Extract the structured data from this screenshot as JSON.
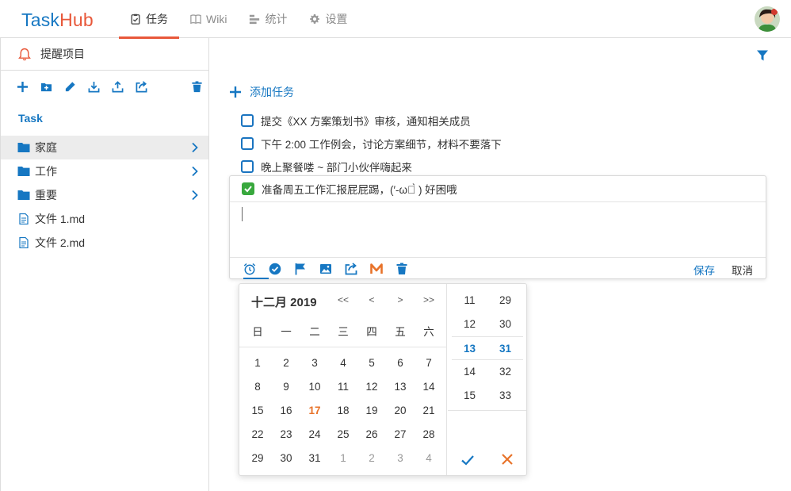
{
  "app": {
    "logo_task": "Task",
    "logo_hub": "Hub"
  },
  "nav": [
    {
      "label": "任务",
      "icon": "clipboard-check-icon",
      "active": true
    },
    {
      "label": "Wiki",
      "icon": "book-icon",
      "active": false
    },
    {
      "label": "统计",
      "icon": "bar-list-icon",
      "active": false
    },
    {
      "label": "设置",
      "icon": "gear-icon",
      "active": false
    }
  ],
  "sidebar": {
    "remind_label": "提醒项目",
    "toolbar_icons": [
      "add-icon",
      "add-folder-icon",
      "edit-icon",
      "download-icon",
      "upload-icon",
      "move-icon",
      "trash-icon"
    ],
    "section_title": "Task",
    "items": [
      {
        "label": "家庭",
        "type": "folder",
        "selected": true
      },
      {
        "label": "工作",
        "type": "folder",
        "selected": false
      },
      {
        "label": "重要",
        "type": "folder",
        "selected": false
      },
      {
        "label": "文件 1.md",
        "type": "file",
        "selected": false
      },
      {
        "label": "文件 2.md",
        "type": "file",
        "selected": false
      }
    ]
  },
  "main": {
    "add_task_label": "添加任务",
    "todos": [
      {
        "text": "提交《XX 方案策划书》审核，通知相关成员",
        "checked": false
      },
      {
        "text": "下午 2:00 工作例会，讨论方案细节，材料不要落下",
        "checked": false
      },
      {
        "text": "晚上聚餐喽 ~ 部门小伙伴嗨起来",
        "checked": false
      }
    ],
    "editing": {
      "text": "准备周五工作汇报屁屁踢，(′-ωก̀ ) 好困哦",
      "checked": true,
      "input_value": "",
      "save_label": "保存",
      "cancel_label": "取消",
      "toolbar_icons": [
        "alarm-clock-icon",
        "check-circle-icon",
        "flag-icon",
        "image-icon",
        "move-icon",
        "markdown-icon",
        "trash-icon"
      ]
    }
  },
  "datepicker": {
    "title": "十二月 2019",
    "nav": [
      "<<",
      "<",
      ">",
      ">>"
    ],
    "weekdays": [
      "日",
      "一",
      "二",
      "三",
      "四",
      "五",
      "六"
    ],
    "weeks": [
      [
        "1",
        "2",
        "3",
        "4",
        "5",
        "6",
        "7"
      ],
      [
        "8",
        "9",
        "10",
        "11",
        "12",
        "13",
        "14"
      ],
      [
        "15",
        "16",
        "17",
        "18",
        "19",
        "20",
        "21"
      ],
      [
        "22",
        "23",
        "24",
        "25",
        "26",
        "27",
        "28"
      ],
      [
        "29",
        "30",
        "31",
        "1",
        "2",
        "3",
        "4"
      ]
    ],
    "today": "17",
    "time_rows": [
      {
        "hour": "11",
        "minute": "29",
        "selected": false
      },
      {
        "hour": "12",
        "minute": "30",
        "selected": false
      },
      {
        "hour": "13",
        "minute": "31",
        "selected": true
      },
      {
        "hour": "14",
        "minute": "32",
        "selected": false
      },
      {
        "hour": "15",
        "minute": "33",
        "selected": false
      }
    ]
  },
  "colors": {
    "accent_blue": "#1677c2",
    "accent_orange": "#e8583a",
    "check_green": "#38a83d"
  }
}
